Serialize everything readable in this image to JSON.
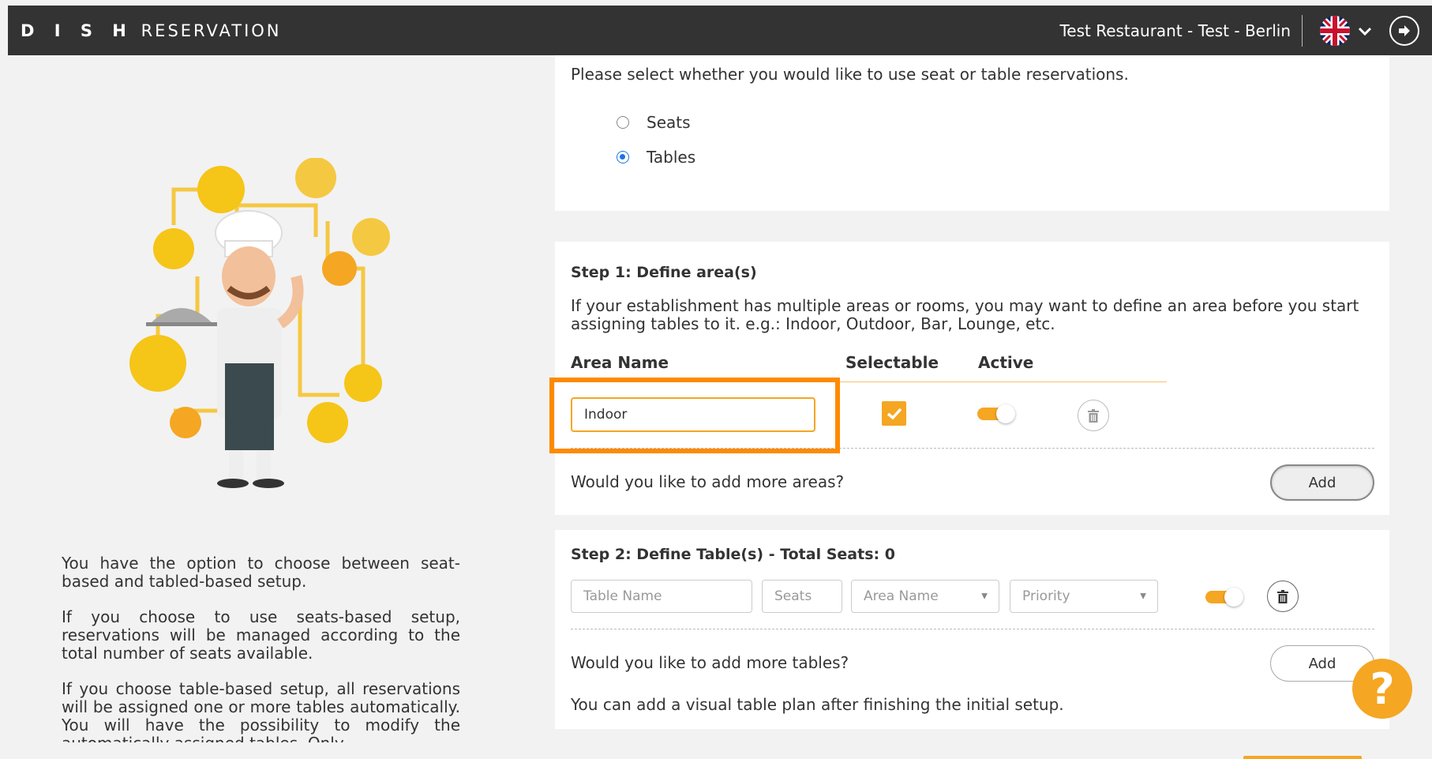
{
  "header": {
    "logo_bold": "D I S H",
    "logo_rest": "RESERVATION",
    "restaurant": "Test Restaurant - Test - Berlin",
    "language_icon": "uk-flag-icon",
    "dropdown_icon": "chevron-down-icon",
    "logout_icon": "logout-icon"
  },
  "left_panel": {
    "paragraphs": [
      "You have the option to choose between seat-based and tabled-based setup.",
      "If you choose to use seats-based setup, reservations will be managed according to the total number of seats available.",
      "If you choose table-based setup, all reservations will be assigned one or more tables automatically. You will have the possibility to modify the automatically assigned tables. Only"
    ]
  },
  "reservation_type": {
    "prompt": "Please select whether you would like to use seat or table reservations.",
    "options": [
      {
        "label": "Seats",
        "checked": false
      },
      {
        "label": "Tables",
        "checked": true
      }
    ]
  },
  "step1": {
    "title": "Step 1: Define area(s)",
    "description": "If your establishment has multiple areas or rooms, you may want to define an area before you start assigning tables to it. e.g.: Indoor, Outdoor, Bar, Lounge, etc.",
    "columns": [
      "Area Name",
      "Selectable",
      "Active"
    ],
    "area_name_value": "Indoor",
    "selectable": true,
    "active": true,
    "add_prompt": "Would you like to add more areas?",
    "add_label": "Add"
  },
  "step2": {
    "title": "Step 2: Define Table(s) - Total Seats: 0",
    "table_name_placeholder": "Table Name",
    "seats_placeholder": "Seats",
    "area_select_value": "Area Name",
    "priority_select_value": "Priority",
    "active": true,
    "add_prompt": "Would you like to add more tables?",
    "add_label": "Add",
    "footer_note": "You can add a visual table plan after finishing the initial setup."
  },
  "help": {
    "label": "?"
  },
  "colors": {
    "accent": "#f5a623",
    "highlight": "#ff8a00",
    "header_bg": "#333333",
    "radio": "#1a73e8"
  }
}
